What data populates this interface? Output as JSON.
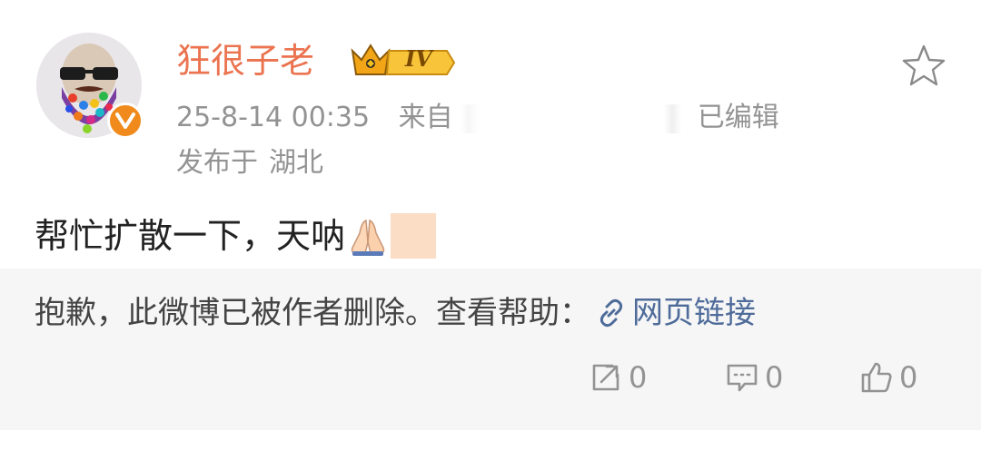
{
  "post": {
    "username": "狂很子老",
    "level_badge": "IV",
    "timestamp": "25-8-14 00:35",
    "source_prefix": "来自",
    "edited_label": "已编辑",
    "location_prefix": "发布于",
    "location": "湖北",
    "text": "帮忙扩散一下，天呐",
    "icons": [
      "star-icon",
      "verified-v-icon",
      "crown-icon",
      "pray-emoji",
      "skin-tone-swatch"
    ]
  },
  "repost": {
    "deleted_notice": "抱歉，此微博已被作者删除。查看帮助：",
    "link_label": "网页链接",
    "link_color": "#4e6b9a"
  },
  "actions": {
    "repost_count": "0",
    "comment_count": "0",
    "like_count": "0"
  },
  "colors": {
    "username": "#eb7350",
    "verified_badge": "#f08a1c",
    "meta_text": "#939393",
    "repost_bg": "#f6f6f6"
  }
}
